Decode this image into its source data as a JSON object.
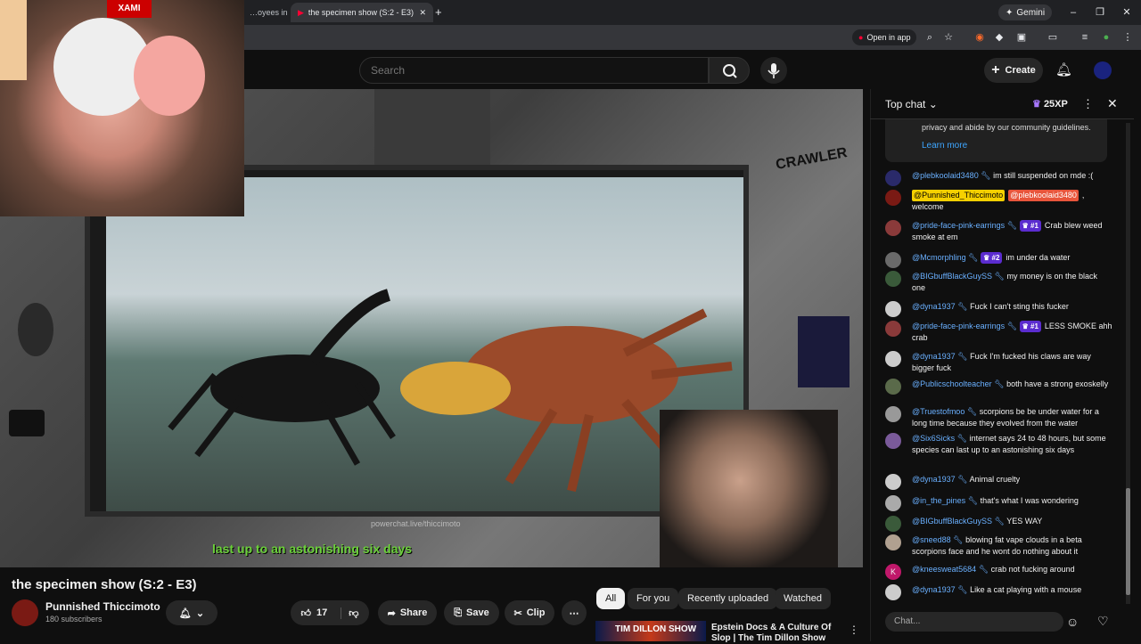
{
  "browser": {
    "tabs": [
      {
        "label": "…oyees in"
      },
      {
        "label": "the specimen show (S:2 - E3)"
      }
    ],
    "gemini_label": "Gemini",
    "open_in_app_label": "Open in app"
  },
  "header": {
    "search_placeholder": "Search",
    "create_label": "Create"
  },
  "video": {
    "subtitle": "last up to an astonishing six days",
    "watermark": "powerchat.live/thiccimoto",
    "wall_text": "CRAWLER"
  },
  "below_video": {
    "title": "the specimen show (S:2 - E3)",
    "channel_name": "Punnished Thiccimoto",
    "subscribers": "180 subscribers",
    "like_count": "17",
    "share_label": "Share",
    "save_label": "Save",
    "clip_label": "Clip"
  },
  "recommend": {
    "chips": [
      "All",
      "For you",
      "Recently uploaded",
      "Watched"
    ],
    "first_title": "Epstein Docs & A Culture Of Slop | The Tim Dillon Show",
    "thumb_text": "TIM DILLON SHOW"
  },
  "chat": {
    "mode_label": "Top chat",
    "xp_label": "25XP",
    "banner_text": "privacy and abide by our community guidelines.",
    "learn_more": "Learn more",
    "input_placeholder": "Chat...",
    "messages": [
      {
        "user": "@plebkoolaid3480",
        "text": "im still suspended on mde :(",
        "avatar": "#2a2a6a"
      },
      {
        "user": "",
        "text": ", welcome",
        "avatar": "#7a1a14",
        "mentions": [
          "@Punnished_Thiccimoto",
          "@plebkoolaid3480"
        ]
      },
      {
        "user": "@pride-face-pink-earrings",
        "badge": "#1",
        "text": "Crab blew weed smoke at em",
        "avatar": "#8a3a3a"
      },
      {
        "user": "@Mcmorphling",
        "badge": "#2",
        "text": "im under da water",
        "avatar": "#6a6a6a"
      },
      {
        "user": "@BIGbuffBlackGuySS",
        "text": "my money is on the black one",
        "avatar": "#3a5a3a"
      },
      {
        "user": "@dyna1937",
        "text": "Fuck I can't sting this fucker",
        "avatar": "#cccccc"
      },
      {
        "user": "@pride-face-pink-earrings",
        "badge": "#1",
        "text": "LESS SMOKE ahh crab",
        "avatar": "#8a3a3a"
      },
      {
        "user": "@dyna1937",
        "text": "Fuck I'm fucked his claws are way bigger fuck",
        "avatar": "#cccccc"
      },
      {
        "user": "@Publicschoolteacher",
        "text": "both have a strong exoskelly",
        "avatar": "#5a6a4a"
      },
      {
        "user": "@Truestofmoo",
        "text": "scorpions be be under water for a long time because they evolved from the water",
        "avatar": "#999999"
      },
      {
        "user": "@Six6Sicks",
        "text": "internet says 24 to 48 hours, but some species can last up to an astonishing six days",
        "avatar": "#7a5a9a"
      },
      {
        "user": "@dyna1937",
        "text": "Animal cruelty",
        "avatar": "#cccccc"
      },
      {
        "user": "@in_the_pines",
        "text": "that's what I was wondering",
        "avatar": "#aaaaaa"
      },
      {
        "user": "@BIGbuffBlackGuySS",
        "text": "YES WAY",
        "avatar": "#3a5a3a"
      },
      {
        "user": "@sneed88",
        "text": "blowing fat vape clouds in a beta scorpions face and he wont do nothing about it",
        "avatar": "#b0a090"
      },
      {
        "user": "@kneesweat5684",
        "text": "crab not fucking around",
        "avatar": "#c0186a",
        "initial": "K"
      },
      {
        "user": "@dyna1937",
        "text": "Like a cat playing with a mouse",
        "avatar": "#cccccc"
      }
    ]
  },
  "colors": {
    "accent_red": "#ff0033",
    "link_blue": "#3ea6ff",
    "subtitle_green": "#6bd13a",
    "mention_yellow": "#f5d000",
    "mention_red": "#e8553b"
  }
}
